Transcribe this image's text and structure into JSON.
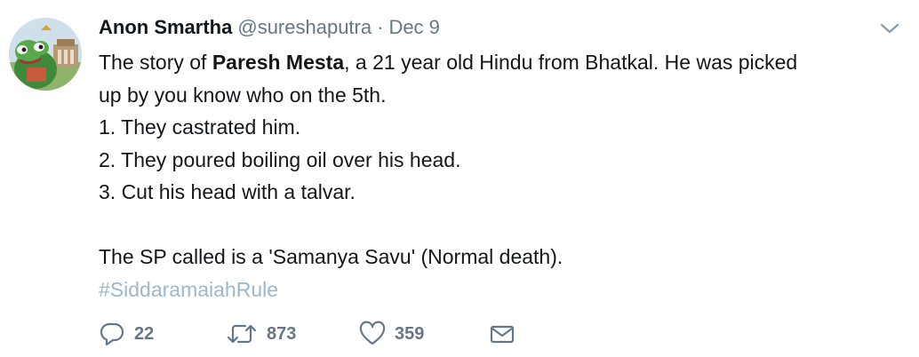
{
  "tweet": {
    "author_name": "Anon Smartha",
    "author_handle": "@sureshaputra",
    "separator": "·",
    "date": "Dec 9",
    "text": {
      "line1_pre": "The story of ",
      "line1_bold": "Paresh Mesta",
      "line1_post": ", a 21 year old Hindu from Bhatkal.  He was picked",
      "line2": "up by you know who on the 5th.",
      "line3": "1. They castrated him.",
      "line4": "2. They poured boiling oil over his head.",
      "line5": "3. Cut his head with a talvar.",
      "line6": "The SP called is a 'Samanya Savu' (Normal death).",
      "hashtag": "#SiddaramaiahRule"
    },
    "actions": {
      "replies": "22",
      "retweets": "873",
      "likes": "359"
    }
  },
  "icons": {
    "avatar": "cartoon-frog-avatar",
    "caret": "chevron-down-icon",
    "reply": "reply-icon",
    "retweet": "retweet-icon",
    "like": "heart-icon",
    "dm": "envelope-icon"
  },
  "colors": {
    "text": "#14171a",
    "secondary": "#657786",
    "hashtag": "#9bb8cf"
  }
}
